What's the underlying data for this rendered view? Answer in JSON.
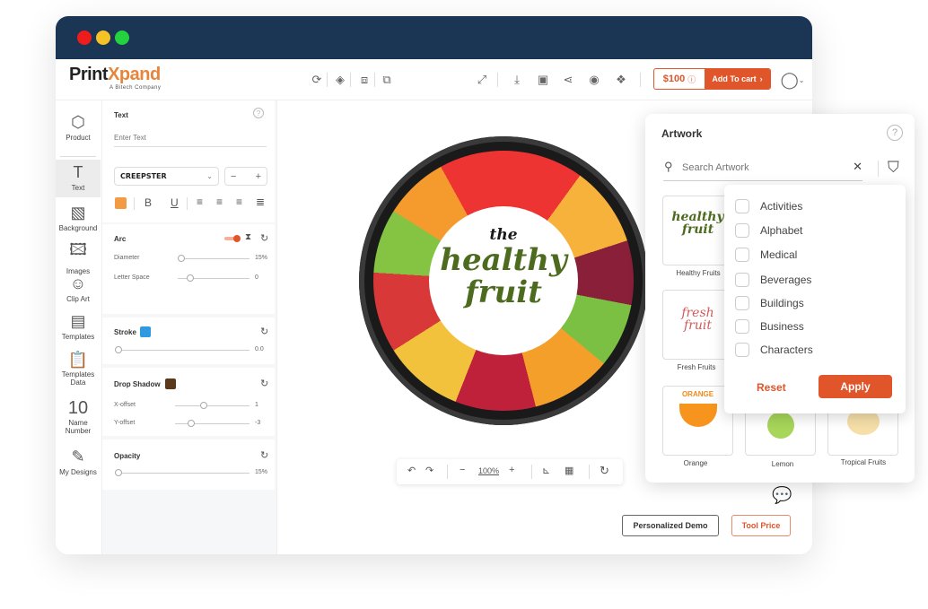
{
  "window": {
    "dots": [
      "#ee1c1c",
      "#f5c326",
      "#24d13f"
    ]
  },
  "header": {
    "logo_part1": "Print",
    "logo_part2": "Xpand",
    "logo_sub": "A Bitech Company",
    "left_icons": [
      "refresh-icon",
      "layers-icon",
      "bring-front-icon",
      "send-back-icon"
    ],
    "right_icons": [
      "fullscreen-icon",
      "download-icon",
      "save-icon",
      "share-icon",
      "preview-icon",
      "3d-view-icon"
    ],
    "price": "$100",
    "add_to_cart": "Add To cart"
  },
  "sidebar": {
    "items": [
      {
        "label": "Product",
        "icon": "cube-icon"
      },
      {
        "label": "Text",
        "icon": "text-icon"
      },
      {
        "label": "Background",
        "icon": "background-icon"
      },
      {
        "label": "Images",
        "icon": "image-icon"
      },
      {
        "label": "Clip Art",
        "icon": "smiley-icon"
      },
      {
        "label": "Templates",
        "icon": "templates-icon"
      },
      {
        "label": "Templates Data",
        "icon": "clipboard-icon"
      },
      {
        "label": "Name Number",
        "icon": "number-icon",
        "glyph": "10"
      },
      {
        "label": "My Designs",
        "icon": "designs-icon"
      }
    ]
  },
  "text_panel": {
    "title": "Text",
    "placeholder": "Enter Text",
    "font": "CREEPSTER",
    "text_color": "#f39a45",
    "arc": {
      "label": "Arc",
      "enabled": true,
      "diameter_label": "Diameter",
      "diameter_value": "15%",
      "letter_space_label": "Letter Space",
      "letter_space_value": "0"
    },
    "stroke": {
      "label": "Stroke",
      "color": "#2f9ae0",
      "value": "0.0"
    },
    "drop_shadow": {
      "label": "Drop Shadow",
      "color": "#5a3a1a",
      "x_label": "X-offset",
      "x_value": "1",
      "y_label": "Y-offset",
      "y_value": "-3"
    },
    "opacity": {
      "label": "Opacity",
      "value": "15%"
    }
  },
  "design": {
    "line1": "the",
    "line2": "healthy",
    "line3": "fruit"
  },
  "canvas_toolbar": {
    "zoom": "100%"
  },
  "buttons": {
    "demo": "Personalized Demo",
    "tool_price": "Tool Price"
  },
  "artwork": {
    "title": "Artwork",
    "search_placeholder": "Search Artwork",
    "items": [
      {
        "label": "Healthy Fruits"
      },
      {
        "label": "Fresh Fruits"
      },
      {
        "label": "Orange",
        "badge": "ORANGE"
      },
      {
        "label": "Lemon"
      },
      {
        "label": "Tropical Fruits"
      }
    ]
  },
  "filter": {
    "categories": [
      "Activities",
      "Alphabet",
      "Medical",
      "Beverages",
      "Buildings",
      "Business",
      "Characters"
    ],
    "reset": "Reset",
    "apply": "Apply"
  }
}
